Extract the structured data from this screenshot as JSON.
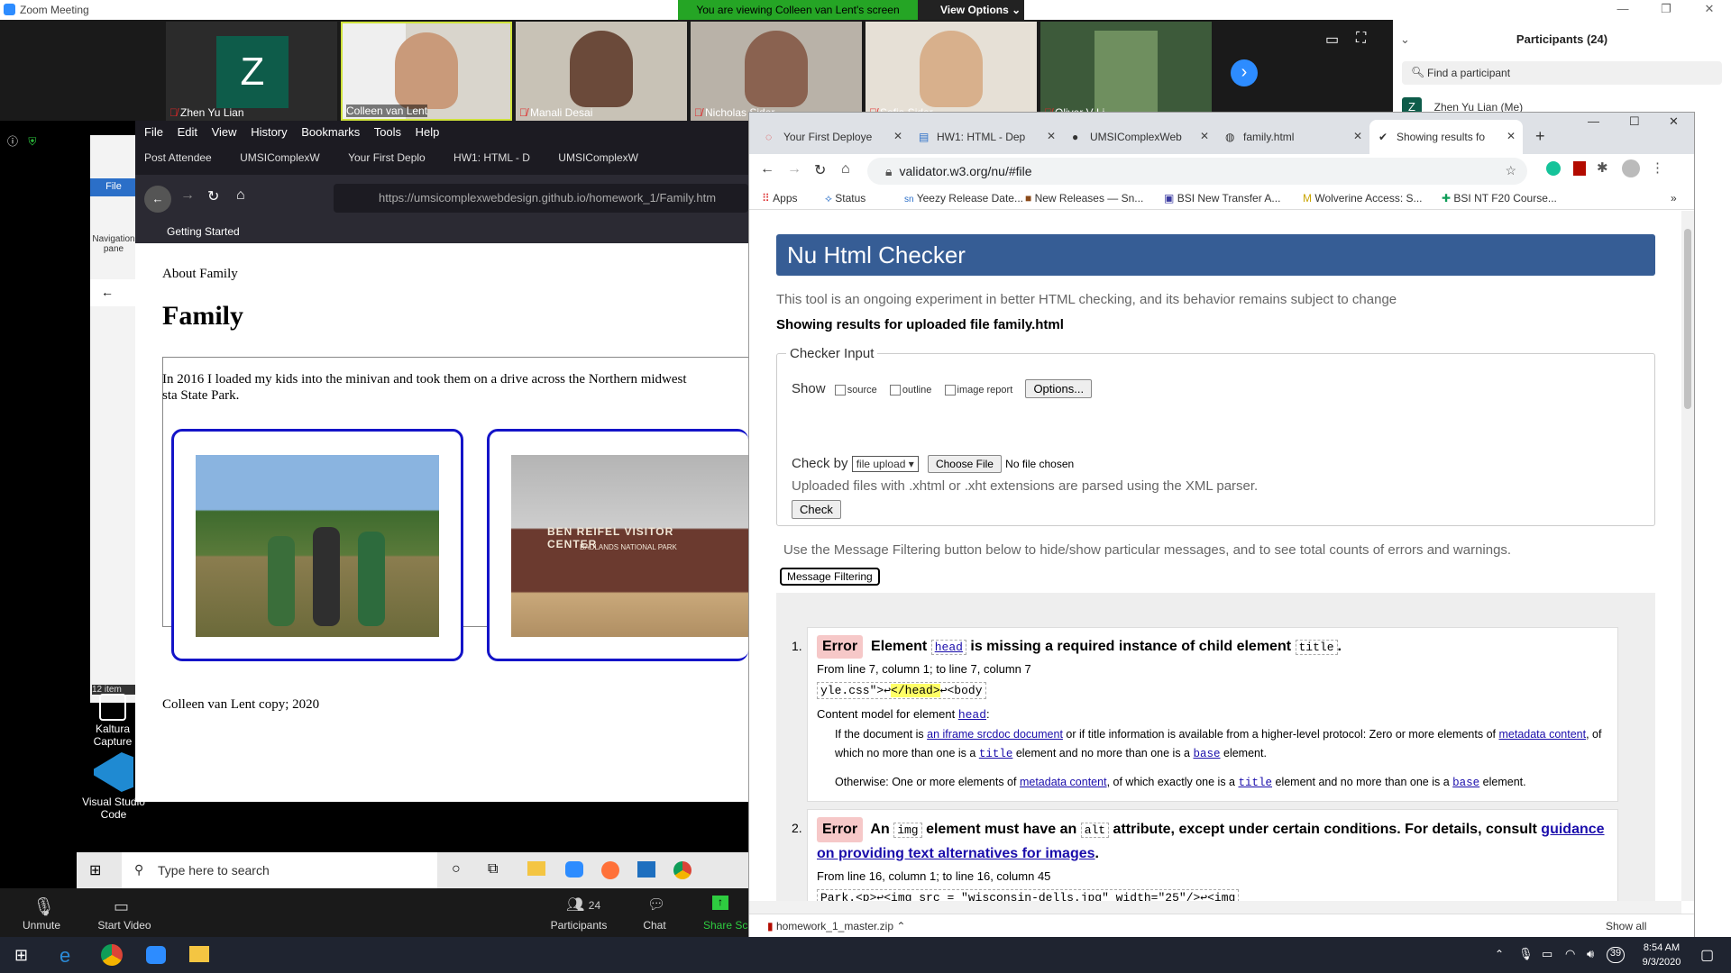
{
  "zoom": {
    "window_title": "Zoom Meeting",
    "viewing_banner": "You are viewing Colleen van Lent's screen",
    "view_options": "View Options",
    "participants_header": "Participants (24)",
    "find_participant": "Find a participant",
    "first_participant": "Zhen Yu Lian (Me)",
    "participants_count": "24",
    "video_tiles": [
      {
        "name": "Zhen Yu Lian",
        "initial": "Z",
        "muted": true
      },
      {
        "name": "Colleen van Lent",
        "muted": false
      },
      {
        "name": "Manali Desai",
        "muted": true
      },
      {
        "name": "Nicholas Sider",
        "muted": true
      },
      {
        "name": "Sofia Sider",
        "muted": true
      },
      {
        "name": "Oliver V Li",
        "muted": true
      }
    ],
    "controls": {
      "unmute": "Unmute",
      "start_video": "Start Video",
      "participants": "Participants",
      "chat": "Chat",
      "share": "Share Sc"
    }
  },
  "firefox": {
    "menu": [
      "File",
      "Edit",
      "View",
      "History",
      "Bookmarks",
      "Tools",
      "Help"
    ],
    "tabs": [
      "Post Attendee",
      "UMSIComplexW",
      "Your First Deplo",
      "HW1: HTML - D",
      "UMSIComplexW"
    ],
    "url": "https://umsicomplexwebdesign.github.io/homework_1/Family.htm",
    "bookmark": "Getting Started",
    "page": {
      "nav": "About Family",
      "heading": "Family",
      "paragraph": "In 2016 I loaded my kids into the minivan and took them on a drive across the Northern midwest sta State Park.",
      "sign_text": "BEN REIFEL VISITOR CENTER",
      "sign_sub": "BADLANDS NATIONAL PARK",
      "footer": "Colleen van Lent copy; 2020"
    }
  },
  "explorer": {
    "file_label": "File",
    "nav_pane": "Navigation pane",
    "items": "12 item"
  },
  "desktop_icons": [
    {
      "label": "Kaltura Capture"
    },
    {
      "label": "Visual Studio Code"
    }
  ],
  "inner_taskbar": {
    "search_placeholder": "Type here to search"
  },
  "chrome": {
    "tabs": [
      {
        "label": "Your First Deploye",
        "active": false
      },
      {
        "label": "HW1: HTML - Dep",
        "active": false
      },
      {
        "label": "UMSIComplexWeb",
        "active": false
      },
      {
        "label": "family.html",
        "active": false
      },
      {
        "label": "Showing results fo",
        "active": true
      }
    ],
    "url": "validator.w3.org/nu/#file",
    "bookmarks": [
      "Apps",
      "Status",
      "Yeezy Release Date...",
      "New Releases — Sn...",
      "BSI New Transfer A...",
      "Wolverine Access: S...",
      "BSI NT F20 Course..."
    ],
    "download": "homework_1_master.zip",
    "show_all": "Show all"
  },
  "validator": {
    "title": "Nu Html Checker",
    "subtitle": "This tool is an ongoing experiment in better HTML checking, and its behavior remains subject to change",
    "results_for": "Showing results for uploaded file family.html",
    "checker_input": "Checker Input",
    "show_label": "Show",
    "show_options": [
      "source",
      "outline",
      "image report"
    ],
    "options_button": "Options...",
    "check_by": "Check by",
    "check_by_value": "file upload",
    "choose_file": "Choose File",
    "no_file": "No file chosen",
    "xml_note": "Uploaded files with .xhtml or .xht extensions are parsed using the XML parser.",
    "check_button": "Check",
    "filter_note": "Use the Message Filtering button below to hide/show particular messages, and to see total counts of errors and warnings.",
    "filter_button": "Message Filtering",
    "errors": [
      {
        "num": "1.",
        "tag": "Error",
        "t1": "Element",
        "code1": "head",
        "t2": "is missing a required instance of child element",
        "code2": "title",
        "t3": ".",
        "location": "From line 7, column 1; to line 7, column 7",
        "extract_pre": "yle.css\">↩",
        "extract_hl": "</head>",
        "extract_post": "↩<body",
        "content_model": "Content model for element",
        "content_model_code": "head",
        "cm1_a": "If the document is",
        "cm1_link": "an iframe srcdoc document",
        "cm1_b": "or if title information is available from a higher-level protocol: Zero or more elements of",
        "cm1_link2": "metadata content",
        "cm1_c": ", of which no more than one is a",
        "cm1_code": "title",
        "cm1_d": "element and no more than one is a",
        "cm1_code2": "base",
        "cm1_e": "element.",
        "cm2_a": "Otherwise: One or more elements of",
        "cm2_link": "metadata content",
        "cm2_b": ", of which exactly one is a",
        "cm2_code": "title",
        "cm2_c": "element and no more than one is a",
        "cm2_code2": "base",
        "cm2_d": "element."
      },
      {
        "num": "2.",
        "tag": "Error",
        "t1": "An",
        "code1": "img",
        "t2": "element must have an",
        "code2": "alt",
        "t3": "attribute, except under certain conditions. For details, consult",
        "link": "guidance on providing text alternatives for images",
        "t4": ".",
        "location": "From line 16, column 1; to line 16, column 45",
        "extract": "Park.<p>↩<img src = \"wisconsin-dells.jpg\" width=\"25\"/>↩<img"
      }
    ]
  },
  "system": {
    "time": "8:54 AM",
    "date": "9/3/2020",
    "notifications": "39"
  }
}
